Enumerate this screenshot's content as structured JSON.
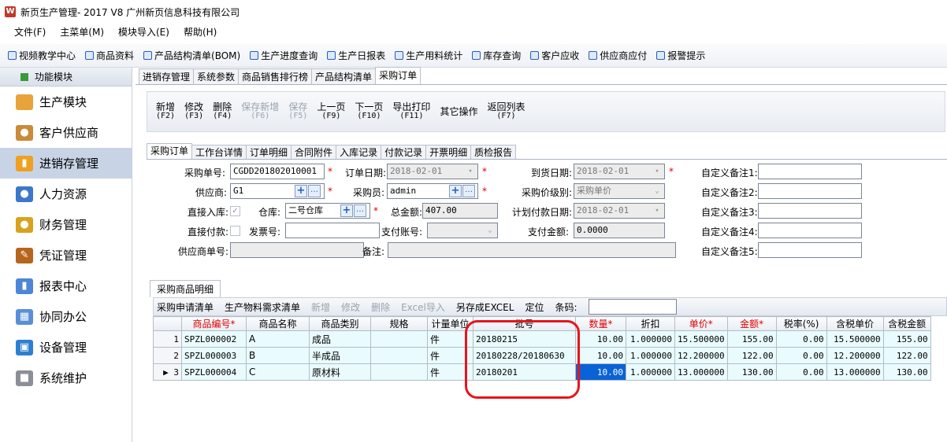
{
  "title": "新页生产管理- 2017 V8 广州新页信息科技有限公司",
  "menu": [
    "文件(F)",
    "主菜单(M)",
    "模块导入(E)",
    "帮助(H)"
  ],
  "toolbar": [
    "视频教学中心",
    "商品资料",
    "产品结构清单(BOM)",
    "生产进度查询",
    "生产日报表",
    "生产用料统计",
    "库存查询",
    "客户应收",
    "供应商应付",
    "报警提示"
  ],
  "sidebar": {
    "header": "功能模块",
    "items": [
      {
        "label": "生产模块",
        "icon": "folder-icon"
      },
      {
        "label": "客户供应商",
        "icon": "people-icon"
      },
      {
        "label": "进销存管理",
        "icon": "bar-chart-icon"
      },
      {
        "label": "人力资源",
        "icon": "person-icon"
      },
      {
        "label": "财务管理",
        "icon": "coins-icon"
      },
      {
        "label": "凭证管理",
        "icon": "notebook-icon"
      },
      {
        "label": "报表中心",
        "icon": "report-icon"
      },
      {
        "label": "协同办公",
        "icon": "calendar-icon"
      },
      {
        "label": "设备管理",
        "icon": "device-icon"
      },
      {
        "label": "系统维护",
        "icon": "lock-icon"
      }
    ],
    "active_index": 2
  },
  "main_tabs": [
    "进销存管理",
    "系统参数",
    "商品销售排行榜",
    "产品结构清单",
    "采购订单"
  ],
  "actions": [
    {
      "label": "新增",
      "key": "(F2)",
      "enabled": true
    },
    {
      "label": "修改",
      "key": "(F3)",
      "enabled": true
    },
    {
      "label": "删除",
      "key": "(F4)",
      "enabled": true
    },
    {
      "label": "保存新增",
      "key": "(F6)",
      "enabled": false
    },
    {
      "label": "保存",
      "key": "(F5)",
      "enabled": false
    },
    {
      "label": "上一页",
      "key": "(F9)",
      "enabled": true
    },
    {
      "label": "下一页",
      "key": "(F10)",
      "enabled": true
    },
    {
      "label": "导出打印",
      "key": "(F11)",
      "enabled": true
    },
    {
      "label": "其它操作",
      "key": "",
      "enabled": true
    },
    {
      "label": "返回列表",
      "key": "(F7)",
      "enabled": true
    }
  ],
  "sub_tabs": [
    "采购订单",
    "工作台详情",
    "订单明细",
    "合同附件",
    "入库记录",
    "付款记录",
    "开票明细",
    "质检报告"
  ],
  "form": {
    "order_no_label": "采购单号:",
    "order_no": "CGDD201802010001",
    "order_date_label": "订单日期:",
    "order_date": "2018-02-01",
    "arrival_date_label": "到货日期:",
    "arrival_date": "2018-02-01",
    "supplier_label": "供应商:",
    "supplier": "G1",
    "buyer_label": "采购员:",
    "buyer": "admin",
    "price_level_label": "采购价级别:",
    "price_level": "采购单价",
    "direct_in_label": "直接入库:",
    "warehouse_label": "仓库:",
    "warehouse": "二号仓库",
    "total_label": "总金额:",
    "total": "407.00",
    "plan_pay_date_label": "计划付款日期:",
    "plan_pay_date": "2018-02-01",
    "direct_pay_label": "直接付款:",
    "invoice_label": "发票号:",
    "invoice": "",
    "pay_account_label": "支付账号:",
    "pay_account": "",
    "pay_amount_label": "支付金额:",
    "pay_amount": "0.0000",
    "supplier_order_label": "供应商单号:",
    "supplier_order": "",
    "remark_label": "备注:",
    "remark": "",
    "custom1_label": "自定义备注1:",
    "custom2_label": "自定义备注2:",
    "custom3_label": "自定义备注3:",
    "custom4_label": "自定义备注4:",
    "custom5_label": "自定义备注5:"
  },
  "detail_tab": "采购商品明细",
  "grid_toolbar": [
    {
      "label": "采购申请清单",
      "enabled": true
    },
    {
      "label": "生产物料需求清单",
      "enabled": true
    },
    {
      "label": "新增",
      "enabled": false
    },
    {
      "label": "修改",
      "enabled": false
    },
    {
      "label": "删除",
      "enabled": false
    },
    {
      "label": "Excel导入",
      "enabled": false
    },
    {
      "label": "另存成EXCEL",
      "enabled": true
    },
    {
      "label": "定位",
      "enabled": true
    }
  ],
  "barcode_label": "条码:",
  "columns": [
    "商品编号*",
    "商品名称",
    "商品类别",
    "规格",
    "计量单位",
    "批号",
    "数量*",
    "折扣",
    "单价*",
    "金额*",
    "税率(%)",
    "含税单价",
    "含税金额"
  ],
  "rows": [
    {
      "no": "1",
      "marker": "",
      "code": "SPZL000002",
      "name": "A",
      "category": "成品",
      "spec": "",
      "unit": "件",
      "batch": "20180215",
      "qty": "10.00",
      "discount": "1.000000",
      "price": "15.500000",
      "amount": "155.00",
      "tax": "0.00",
      "tax_price": "15.500000",
      "tax_amount": "155.00"
    },
    {
      "no": "2",
      "marker": "",
      "code": "SPZL000003",
      "name": "B",
      "category": "半成品",
      "spec": "",
      "unit": "件",
      "batch": "20180228/20180630",
      "qty": "10.00",
      "discount": "1.000000",
      "price": "12.200000",
      "amount": "122.00",
      "tax": "0.00",
      "tax_price": "12.200000",
      "tax_amount": "122.00"
    },
    {
      "no": "3",
      "marker": "▶",
      "code": "SPZL000004",
      "name": "C",
      "category": "原材料",
      "spec": "",
      "unit": "件",
      "batch": "20180201",
      "qty": "10.00",
      "discount": "1.000000",
      "price": "13.000000",
      "amount": "130.00",
      "tax": "0.00",
      "tax_price": "13.000000",
      "tax_amount": "130.00"
    }
  ],
  "colors": {
    "required": "#e00000",
    "selection": "#0a63d6",
    "row_bg": "#e9fbfc",
    "highlight": "#e8141c"
  }
}
